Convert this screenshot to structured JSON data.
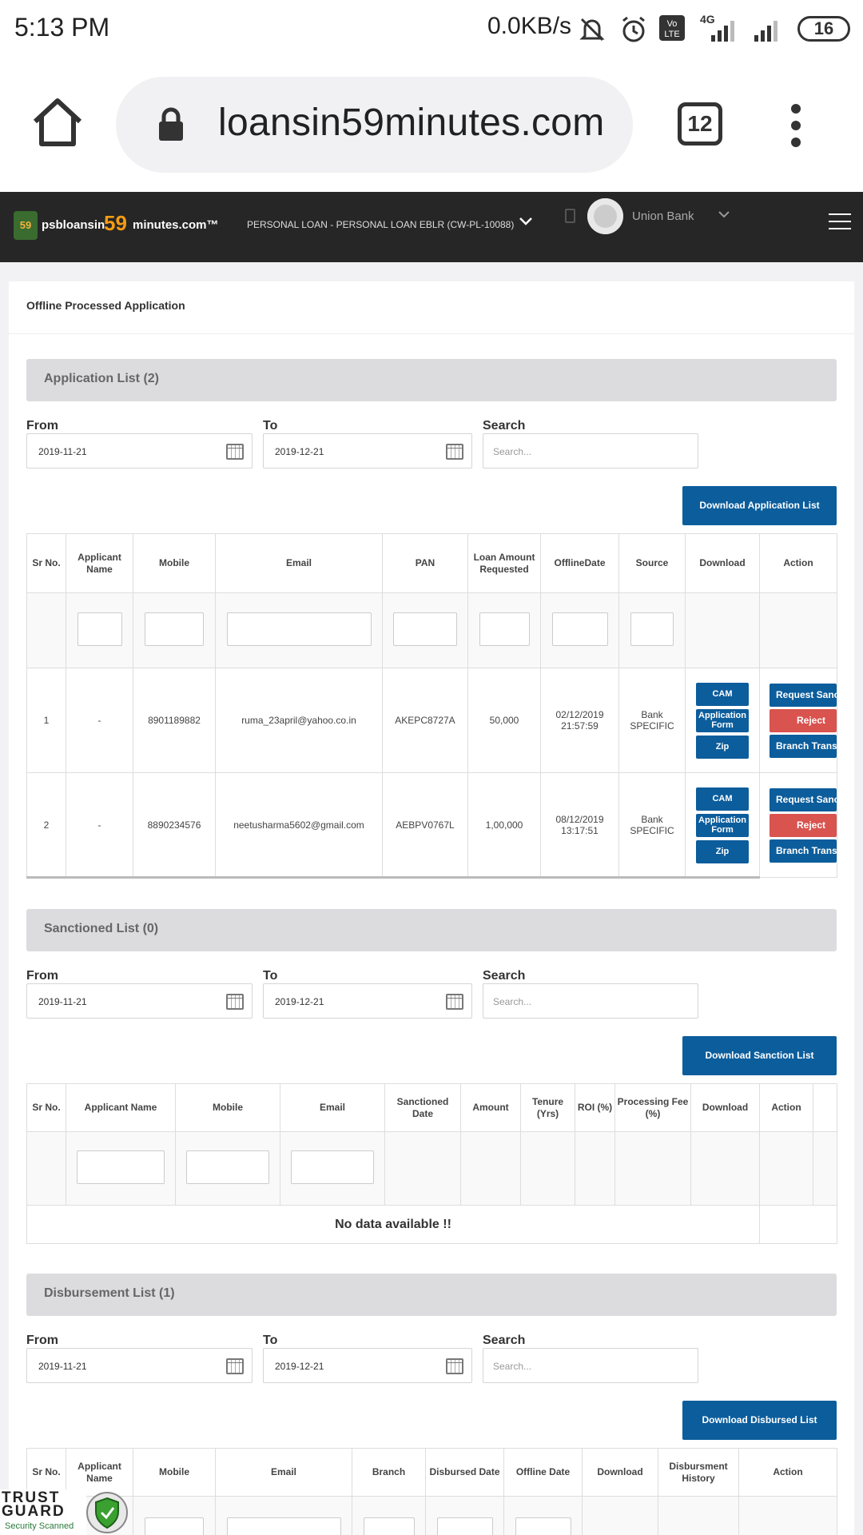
{
  "status": {
    "time": "5:13 PM",
    "speed": "0.0KB/s",
    "network": "4G",
    "battery": "16"
  },
  "browser": {
    "url": "loansin59minutes.com",
    "tab_count": "12"
  },
  "header": {
    "logo_badge": "59",
    "logo_text1": "psbloansin",
    "logo_59": "59",
    "logo_text2": "minutes.com™",
    "product": "PERSONAL LOAN - PERSONAL LOAN EBLR (CW-PL-10088)",
    "bank": "Union Bank"
  },
  "page_title": "Offline Processed Application",
  "labels": {
    "from": "From",
    "to": "To",
    "search": "Search",
    "search_placeholder": "Search...",
    "from_date": "2019-11-21",
    "to_date": "2019-12-21"
  },
  "application": {
    "title": "Application List (2)",
    "download": "Download Application List",
    "columns": [
      "Sr No.",
      "Applicant Name",
      "Mobile",
      "Email",
      "PAN",
      "Loan Amount Requested",
      "OfflineDate",
      "Source",
      "Download",
      "Action"
    ],
    "rows": [
      {
        "sr": "1",
        "name": "-",
        "mobile": "8901189882",
        "email": "ruma_23april@yahoo.co.in",
        "pan": "AKEPC8727A",
        "amount": "50,000",
        "date": "02/12/2019",
        "time": "21:57:59",
        "source": "Bank SPECIFIC"
      },
      {
        "sr": "2",
        "name": "-",
        "mobile": "8890234576",
        "email": "neetusharma5602@gmail.com",
        "pan": "AEBPV0767L",
        "amount": "1,00,000",
        "date": "08/12/2019",
        "time": "13:17:51",
        "source": "Bank SPECIFIC"
      }
    ],
    "buttons": {
      "cam": "CAM",
      "form": "Application Form",
      "zip": "Zip",
      "request": "Request Sanction",
      "reject": "Reject",
      "transfer": "Branch Transfer"
    }
  },
  "sanctioned": {
    "title": "Sanctioned List (0)",
    "download": "Download Sanction List",
    "columns": [
      "Sr No.",
      "Applicant Name",
      "Mobile",
      "Email",
      "Sanctioned Date",
      "Amount",
      "Tenure (Yrs)",
      "ROI (%)",
      "Processing Fee (%)",
      "Download",
      "Action"
    ],
    "empty": "No data available !!"
  },
  "disbursement": {
    "title": "Disbursement List (1)",
    "download": "Download Disbursed List",
    "columns": [
      "Sr No.",
      "Applicant Name",
      "Mobile",
      "Email",
      "Branch",
      "Disbursed Date",
      "Offline Date",
      "Download",
      "Disbursment History",
      "Action"
    ]
  },
  "trust": {
    "title1": "TRUST",
    "title2": "GUARD",
    "subtitle": "Security Scanned"
  }
}
